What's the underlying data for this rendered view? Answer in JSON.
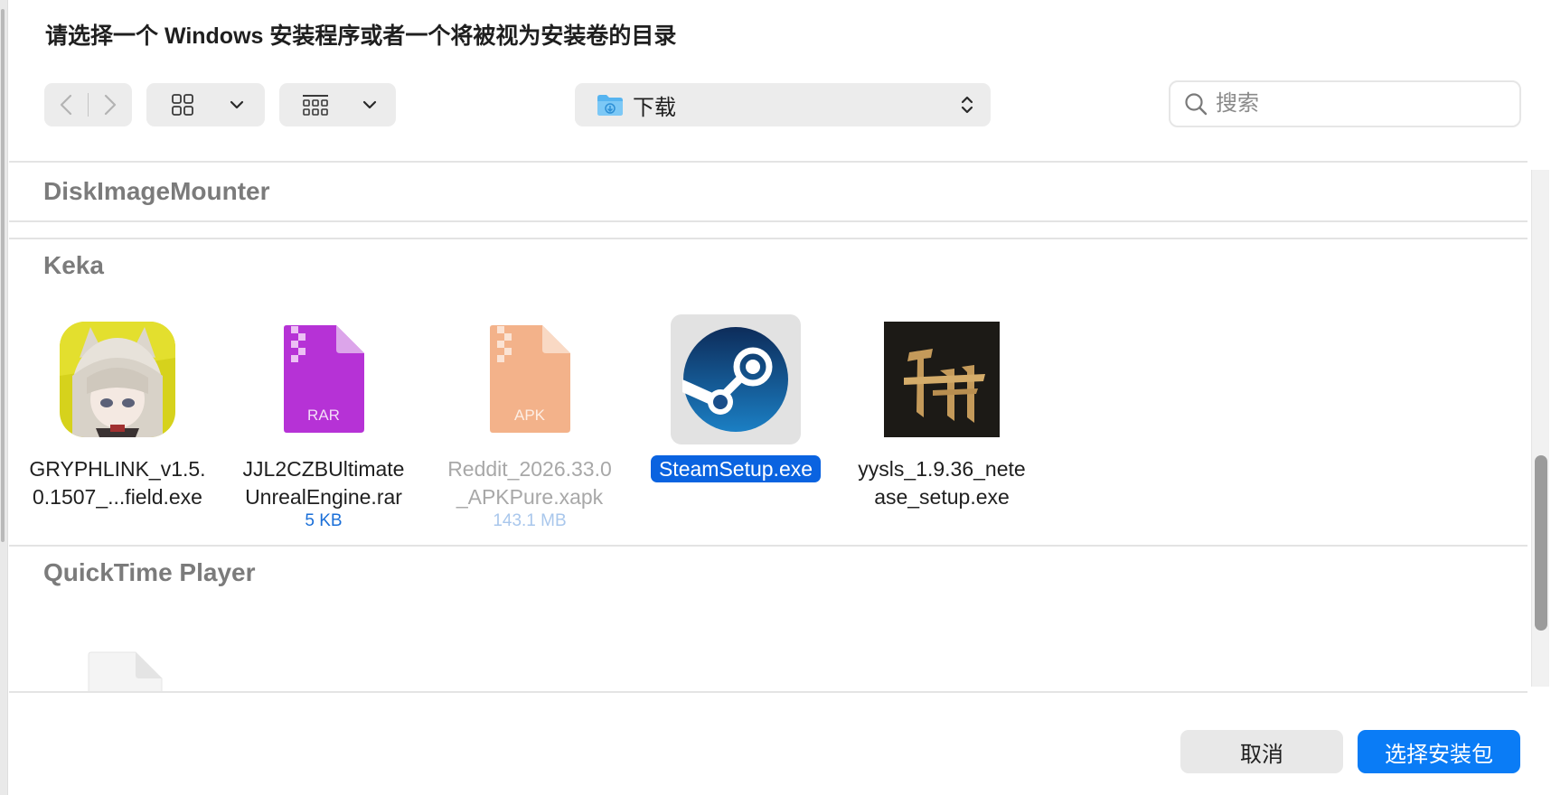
{
  "dialog": {
    "title": "请选择一个 Windows 安装程序或者一个将被视为安装卷的目录"
  },
  "toolbar": {
    "back_icon": "chevron-left-icon",
    "forward_icon": "chevron-right-icon",
    "view_icon_grid": "grid-view-icon",
    "view_icon_group": "group-view-icon",
    "location_label": "下载",
    "location_icon": "downloads-folder-icon",
    "search_placeholder": "搜索"
  },
  "groups": [
    {
      "name": "DiskImageMounter",
      "items": []
    },
    {
      "name": "Keka",
      "items": [
        {
          "name_line1": "GRYPHLINK_v1.5.",
          "name_line2": "0.1507_...field.exe",
          "size": "",
          "icon": "gryphlink-app-icon",
          "selected": false,
          "dimmed": false
        },
        {
          "name_line1": "JJL2CZBUltimate",
          "name_line2": "UnrealEngine.rar",
          "size": "5 KB",
          "icon": "rar-archive-icon",
          "icon_label": "RAR",
          "selected": false,
          "dimmed": false
        },
        {
          "name_line1": "Reddit_2026.33.0",
          "name_line2": "_APKPure.xapk",
          "size": "143.1 MB",
          "icon": "apk-archive-icon",
          "icon_label": "APK",
          "selected": false,
          "dimmed": true
        },
        {
          "name_line1": "SteamSetup.exe",
          "name_line2": "",
          "size": "",
          "icon": "steam-app-icon",
          "selected": true,
          "dimmed": false
        },
        {
          "name_line1": "yysls_1.9.36_nete",
          "name_line2": "ase_setup.exe",
          "size": "",
          "icon": "yysls-app-icon",
          "selected": false,
          "dimmed": false
        }
      ]
    },
    {
      "name": "QuickTime Player",
      "items": [
        {
          "icon": "video-file-icon"
        }
      ]
    }
  ],
  "footer": {
    "cancel_label": "取消",
    "confirm_label": "选择安装包"
  },
  "colors": {
    "accent": "#0a7cf6",
    "selection": "#0a63e0",
    "rar": "#b632d6",
    "apk": "#f3b28a",
    "steam_dark": "#0d2c5a",
    "steam_light": "#1b7fc4"
  }
}
